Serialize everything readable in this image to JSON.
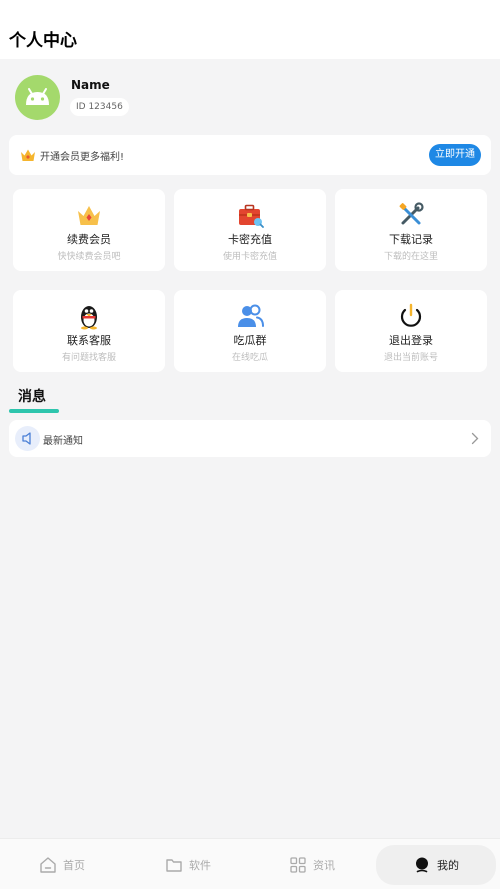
{
  "header": {
    "title": "个人中心"
  },
  "profile": {
    "name": "Name",
    "id_text": "ID 123456"
  },
  "vip": {
    "text": "开通会员更多福利!",
    "button": "立即开通"
  },
  "grid": [
    {
      "label": "续费会员",
      "sub": "快快续费会员吧",
      "icon": "crown-icon"
    },
    {
      "label": "卡密充值",
      "sub": "使用卡密充值",
      "icon": "briefcase-icon"
    },
    {
      "label": "下载记录",
      "sub": "下载的在这里",
      "icon": "tools-icon"
    },
    {
      "label": "联系客服",
      "sub": "有问题找客服",
      "icon": "penguin-icon"
    },
    {
      "label": "吃瓜群",
      "sub": "在线吃瓜",
      "icon": "group-icon"
    },
    {
      "label": "退出登录",
      "sub": "退出当前账号",
      "icon": "power-icon"
    }
  ],
  "messages": {
    "title": "消息",
    "latest": "最新通知"
  },
  "tabbar": {
    "items": [
      {
        "label": "首页",
        "icon": "home-icon"
      },
      {
        "label": "软件",
        "icon": "folder-icon"
      },
      {
        "label": "资讯",
        "icon": "grid-icon"
      },
      {
        "label": "我的",
        "icon": "user-icon",
        "active": true
      }
    ]
  },
  "colors": {
    "accent": "#1e88e5",
    "underline": "#2ec5ad",
    "avatar": "#a4d96c"
  }
}
